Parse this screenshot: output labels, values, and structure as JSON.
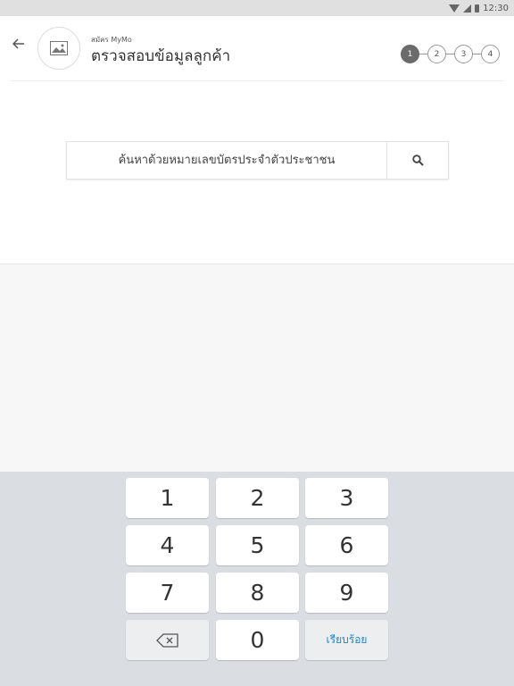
{
  "statusbar": {
    "time": "12:30"
  },
  "header": {
    "subtitle": "สมัคร MyMo",
    "title": "ตรวจสอบข้อมูลลูกค้า",
    "steps": [
      "1",
      "2",
      "3",
      "4"
    ],
    "active_step": 1
  },
  "search": {
    "placeholder": "ค้นหาด้วยหมายเลขบัตรประจำตัวประชาชน"
  },
  "keyboard": {
    "keys": [
      "1",
      "2",
      "3",
      "4",
      "5",
      "6",
      "7",
      "8",
      "9",
      "",
      "0",
      "เรียบร้อย"
    ],
    "done_color": "#1e88c8"
  },
  "icons": [
    "back-arrow-icon",
    "image-placeholder-icon",
    "search-icon",
    "backspace-icon",
    "wifi-icon",
    "cell-signal-icon",
    "battery-icon"
  ]
}
